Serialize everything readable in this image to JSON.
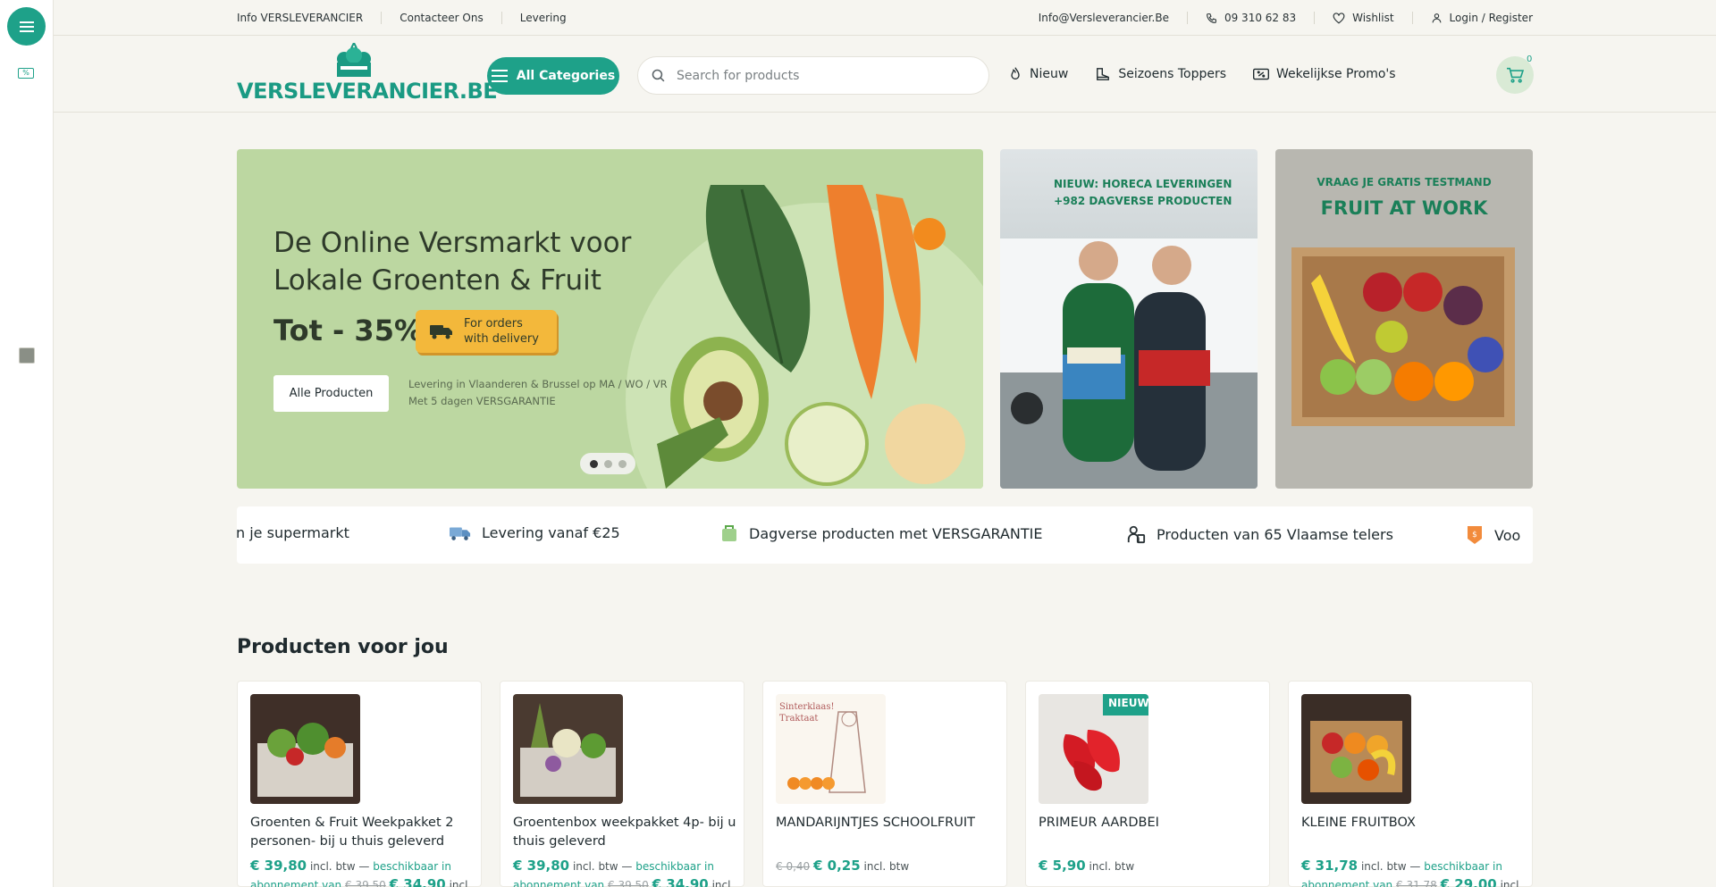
{
  "topbar": {
    "links": [
      "Info VERSLEVERANCIER",
      "Contacteer Ons",
      "Levering"
    ],
    "email": "Info@Versleverancier.Be",
    "phone": "09 310 62 83",
    "wishlist": "Wishlist",
    "login": "Login / Register"
  },
  "header": {
    "logo_text": "VERSLEVERANCIER.BE",
    "categories_label": "All Categories",
    "search_placeholder": "Search for products",
    "nav": [
      "Nieuw",
      "Seizoens Toppers",
      "Wekelijkse Promo's"
    ],
    "cart_count": "0"
  },
  "hero": {
    "title": "De Online Versmarkt voor Lokale Groenten & Fruit",
    "discount": "Tot - 35%",
    "badge": "For orders with delivery",
    "button": "Alle Producten",
    "sub_line1": "Levering in Vlaanderen & Brussel op MA / WO / VR",
    "sub_line2": "Met 5 dagen VERSGARANTIE"
  },
  "promo_horeca": {
    "line1": "NIEUW: HORECA LEVERINGEN",
    "line2": "+982 DAGVERSE PRODUCTEN"
  },
  "promo_work": {
    "sub": "VRAAG JE GRATIS TESTMAND",
    "title": "FRUIT AT WORK"
  },
  "usp": [
    "n je supermarkt",
    "Levering vanaf €25",
    "Dagverse producten met VERSGARANTIE",
    "Producten van 65 Vlaamse telers",
    "Voo"
  ],
  "products_title": "Producten voor jou",
  "products": [
    {
      "title": "Groenten & Fruit Weekpakket 2 personen- bij u thuis geleverd",
      "price": "€ 39,80",
      "vat": "incl. btw —",
      "sub": "beschikbaar in",
      "sub2": "abonnement van",
      "old": "€ 39,50",
      "new": "€ 34,90",
      "tail": "incl. btw /"
    },
    {
      "title": "Groentenbox weekpakket 4p- bij u thuis geleverd",
      "price": "€ 39,80",
      "vat": "incl. btw —",
      "sub": "beschikbaar in",
      "sub2": "abonnement van",
      "old": "€ 39,50",
      "new": "€ 34,90",
      "tail": "incl. btw /"
    },
    {
      "title": "MANDARIJNTJES SCHOOLFRUIT",
      "old": "€ 0,40",
      "price": "€ 0,25",
      "vat": "incl. btw",
      "img_text": "Sinterklaas! Traktaat"
    },
    {
      "title": "PRIMEUR AARDBEI",
      "price": "€ 5,90",
      "vat": "incl. btw",
      "badge": "NIEUW"
    },
    {
      "title": "KLEINE FRUITBOX",
      "price": "€ 31,78",
      "vat": "incl. btw —",
      "sub": "beschikbaar in",
      "sub2": "abonnement van",
      "old": "€ 31,78",
      "new": "€ 29,00",
      "tail": "incl. btw /"
    }
  ],
  "colors": {
    "brand": "#1ea189",
    "accent": "#f3b83b",
    "bg": "#f6f5f0"
  }
}
